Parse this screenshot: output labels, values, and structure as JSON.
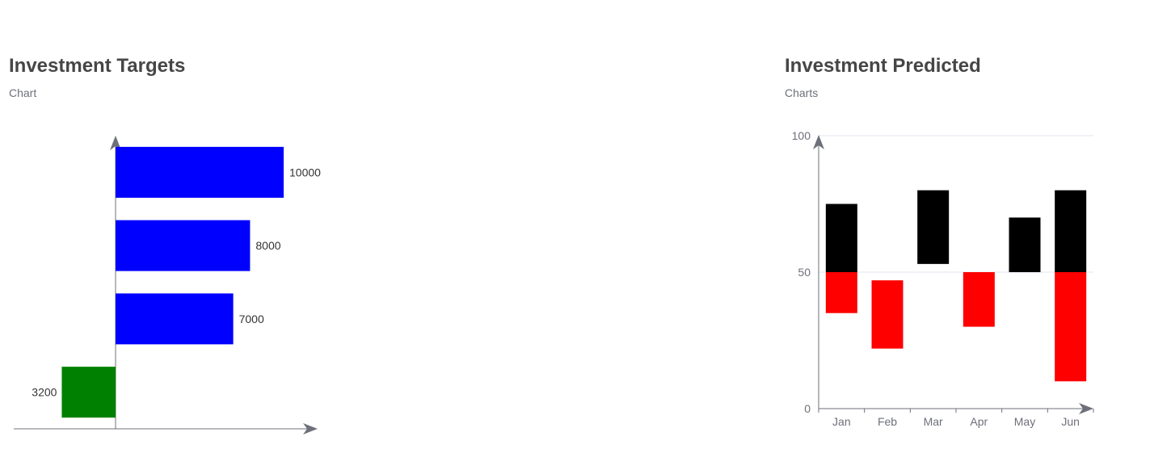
{
  "chart_data": [
    {
      "type": "bar",
      "orientation": "horizontal",
      "title": "Investment Targets",
      "subtitle": "Chart",
      "data_labels": [
        "3200",
        "7000",
        "8000",
        "10000"
      ],
      "values": [
        -3200,
        7000,
        8000,
        10000
      ],
      "bar_colors": [
        "#008000",
        "#0000ff",
        "#0000ff",
        "#0000ff"
      ],
      "xlim": [
        -6000,
        12000
      ],
      "grid": false,
      "axis_color": "#6e7079"
    },
    {
      "type": "bar",
      "stacked": true,
      "title": "Investment Predicted",
      "subtitle": "Charts",
      "categories": [
        "Jan",
        "Feb",
        "Mar",
        "Apr",
        "May",
        "Jun"
      ],
      "ylim": [
        0,
        100
      ],
      "yticks": [
        "0",
        "50",
        "100"
      ],
      "grid": true,
      "bars": [
        {
          "low": 50,
          "high": 75,
          "color": "#000000"
        },
        {
          "low": 35,
          "high": 50,
          "color": "#ff0000"
        },
        {
          "low": 22,
          "high": 47,
          "color": "#ff0000"
        },
        {
          "low": 53,
          "high": 80,
          "color": "#000000"
        },
        {
          "low": 30,
          "high": 50,
          "color": "#ff0000"
        },
        {
          "low": 50,
          "high": 70,
          "color": "#000000"
        },
        {
          "low": 50,
          "high": 80,
          "color": "#000000"
        },
        {
          "low": 10,
          "high": 50,
          "color": "#ff0000"
        }
      ],
      "bar_category_index": [
        0,
        0,
        1,
        2,
        3,
        4,
        5,
        5
      ],
      "axis_color": "#6e7079"
    }
  ]
}
